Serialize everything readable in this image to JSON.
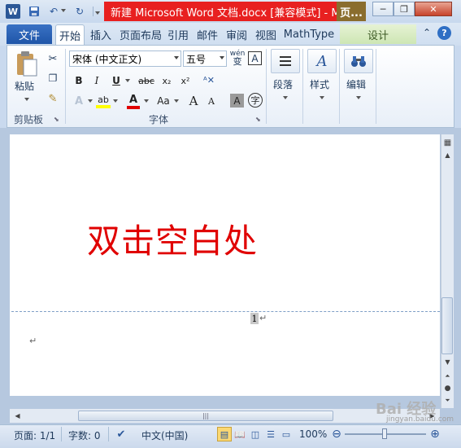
{
  "title": {
    "app_logo": "W",
    "document_title": "新建 Microsoft Word 文档.docx [兼容模式] - M",
    "context_tab_group": "页...",
    "window_buttons": {
      "minimize": "─",
      "restore": "❐",
      "close": "✕"
    }
  },
  "tabs": {
    "file": "文件",
    "items": [
      "开始",
      "插入",
      "页面布局",
      "引用",
      "邮件",
      "审阅",
      "视图",
      "MathType"
    ],
    "design": "设计"
  },
  "ribbon": {
    "clipboard": {
      "paste_label": "粘贴",
      "group_label": "剪贴板"
    },
    "font": {
      "font_name": "宋体 (中文正文)",
      "font_size": "五号",
      "group_label": "字体",
      "buttons": {
        "bold": "B",
        "italic": "I",
        "underline": "U",
        "strike": "abc",
        "sub": "x₂",
        "sup": "x²",
        "grow": "A",
        "shrink": "A",
        "case": "Aa",
        "shade_char": "A",
        "enclose": "字",
        "phonetic": "wén",
        "border_char": "A"
      }
    },
    "paragraph": {
      "label": "段落"
    },
    "styles": {
      "label": "样式"
    },
    "editing": {
      "label": "编辑"
    }
  },
  "document": {
    "body_text": "双击空白处",
    "page_number": "1",
    "para_mark": "↵"
  },
  "status": {
    "page": "页面: 1/1",
    "words": "字数: 0",
    "language": "中文(中国)",
    "zoom": "100%"
  },
  "watermark": {
    "text": "Bai 经验",
    "sub": "jingyan.baidu.com"
  },
  "colors": {
    "title_red": "#e82020",
    "context_tab": "#8a6d2e",
    "file_tab": "#1f55a8",
    "doc_text": "#e00000"
  }
}
